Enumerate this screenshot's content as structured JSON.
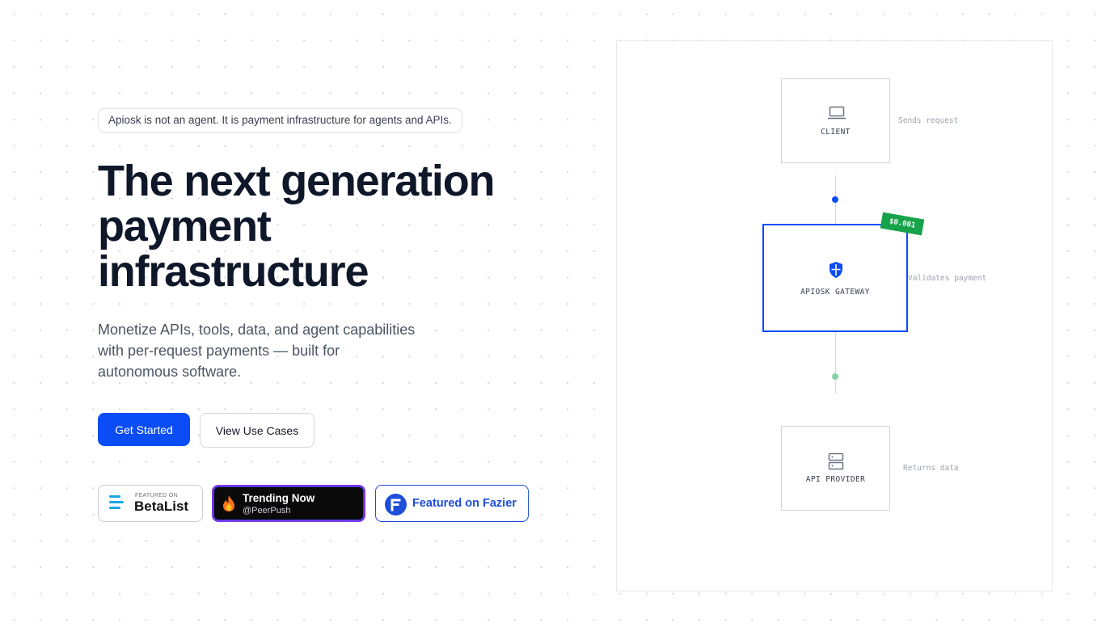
{
  "notice": {
    "text": "Apiosk is not an agent. It is payment infrastructure for agents and APIs."
  },
  "hero": {
    "headline_lines": [
      "The next generation",
      "payment",
      "infrastructure"
    ],
    "subtext_lines": [
      "Monetize APIs, tools, data, and agent capabilities",
      "with per-request payments — built for",
      "autonomous software."
    ]
  },
  "cta": {
    "primary_label": "Get Started",
    "secondary_label": "View Use Cases"
  },
  "badges": {
    "betalist": {
      "small": "FEATURED ON",
      "big": "BetaList"
    },
    "peerpush": {
      "title": "Trending Now",
      "subtitle": "@PeerPush"
    },
    "fazier": {
      "text": "Featured on Fazier"
    }
  },
  "diagram": {
    "client": {
      "label": "CLIENT",
      "note": "Sends request"
    },
    "gateway": {
      "label": "APIOSK GATEWAY",
      "note": "Validates payment",
      "price": "$0.001"
    },
    "provider": {
      "label": "API PROVIDER",
      "note": "Returns data"
    }
  },
  "colors": {
    "accent": "#0a4cf5",
    "price_tag": "#16a34a",
    "fazier": "#1d4ed8",
    "peerpush_border": "#7c3aed",
    "betalist_icon": "#19a7e6"
  },
  "icons": {
    "client": "laptop-icon",
    "gateway": "shield-icon",
    "provider": "server-icon",
    "peerpush": "flame-icon",
    "fazier": "fazier-logo-icon",
    "betalist": "betalist-logo-icon"
  }
}
